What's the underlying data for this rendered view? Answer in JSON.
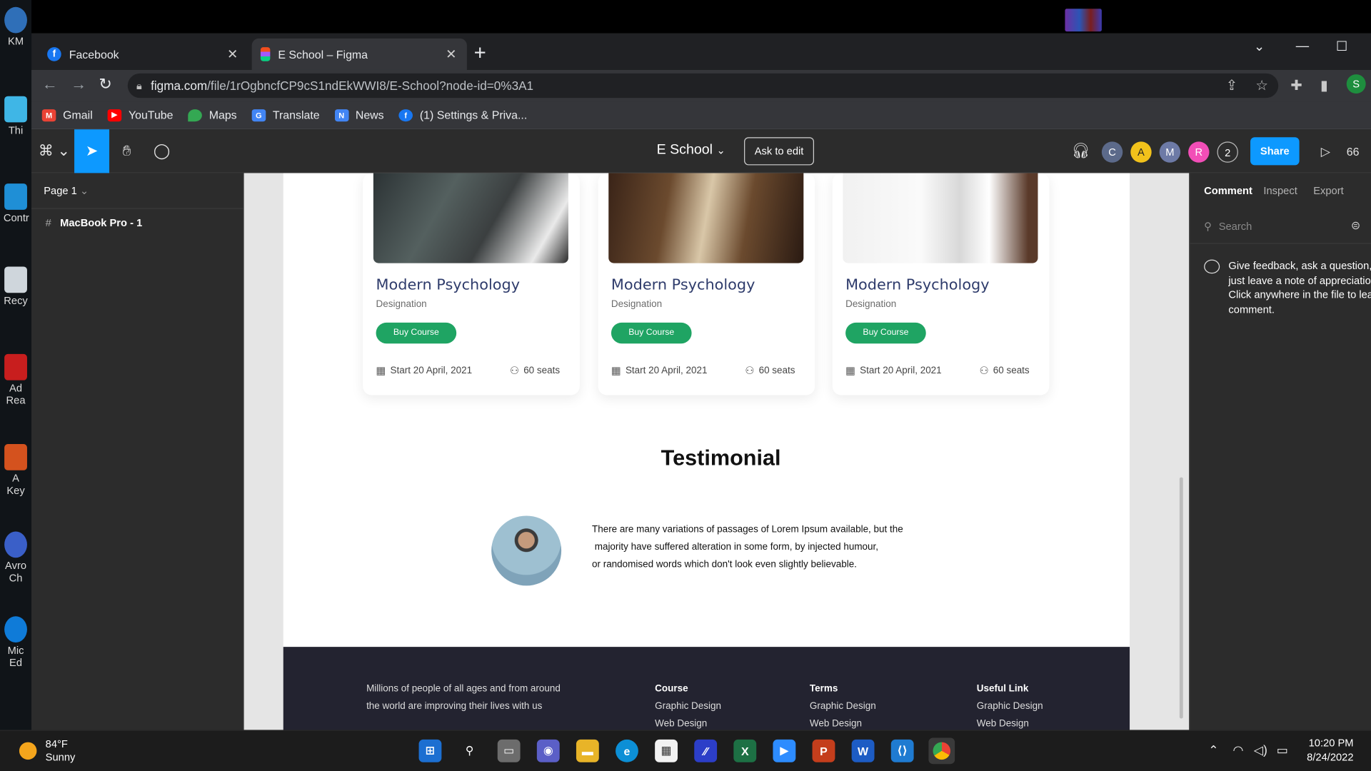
{
  "desktop": {
    "icons": [
      "KM",
      "Thi",
      "Contr",
      "Recy",
      "Ad Rea",
      "A Key",
      "Avro Ch",
      "Mic Ed"
    ]
  },
  "browser": {
    "tabs": [
      {
        "label": "Facebook",
        "icon": "facebook-icon",
        "active": false
      },
      {
        "label": "E School – Figma",
        "icon": "figma-icon",
        "active": true
      }
    ],
    "url_host": "figma.com",
    "url_path": "/file/1rOgbncfCP9cS1ndEkWWI8/E-School?node-id=0%3A1",
    "profile_initial": "S",
    "bookmarks": [
      {
        "label": "Gmail",
        "icon": "gmail-icon",
        "color": "#ea4335"
      },
      {
        "label": "YouTube",
        "icon": "youtube-icon",
        "color": "#ff0000"
      },
      {
        "label": "Maps",
        "icon": "maps-icon",
        "color": "#34a853"
      },
      {
        "label": "Translate",
        "icon": "translate-icon",
        "color": "#4285f4"
      },
      {
        "label": "News",
        "icon": "news-icon",
        "color": "#4285f4"
      },
      {
        "label": "(1) Settings & Priva...",
        "icon": "facebook-icon",
        "color": "#1877f2"
      }
    ]
  },
  "figma": {
    "file_name": "E School",
    "ask_to_edit": "Ask to edit",
    "share": "Share",
    "zoom_partial": "66",
    "collaborators": [
      {
        "initial": "C",
        "color": "#5c6a8a"
      },
      {
        "initial": "A",
        "color": "#f2c21b"
      },
      {
        "initial": "M",
        "color": "#6d7aa6"
      },
      {
        "initial": "R",
        "color": "#f24eb7"
      },
      {
        "initial": "2",
        "color": "#2c2c2c"
      }
    ],
    "page": "Page 1",
    "frame": "MacBook Pro - 1",
    "right_tabs": [
      "Comment",
      "Inspect",
      "Export"
    ],
    "search_placeholder": "Search",
    "comment_hint": "Give feedback, ask a question, or just leave a note of appreciation. Click anywhere in the file to leave a comment."
  },
  "design": {
    "cards": [
      {
        "title": "Modern Psychology",
        "designation": "Designation",
        "button": "Buy Course",
        "start": "Start 20  April, 2021",
        "seats": "60 seats"
      },
      {
        "title": "Modern Psychology",
        "designation": "Designation",
        "button": "Buy Course",
        "start": "Start 20  April, 2021",
        "seats": "60 seats"
      },
      {
        "title": "Modern Psychology",
        "designation": "Designation",
        "button": "Buy Course",
        "start": "Start 20  April, 2021",
        "seats": "60 seats"
      }
    ],
    "testimonial_heading": "Testimonial",
    "testimonial_lines": [
      "There are many variations of passages of Lorem Ipsum available, but the",
      " majority have suffered alteration in some form, by injected humour,",
      "or randomised words which don't look even slightly believable."
    ],
    "footer": {
      "about_lines": [
        "Millions of people of all ages and from around",
        "the world are improving their lives with us"
      ],
      "columns": [
        {
          "heading": "Course",
          "items": [
            "Graphic Design",
            "Web Design"
          ]
        },
        {
          "heading": "Terms",
          "items": [
            "Graphic Design",
            "Web Design"
          ]
        },
        {
          "heading": "Useful Link",
          "items": [
            "Graphic Design",
            "Web Design"
          ]
        }
      ]
    }
  },
  "taskbar": {
    "weather_temp": "84°F",
    "weather_desc": "Sunny",
    "time": "10:20 PM",
    "date": "8/24/2022"
  }
}
